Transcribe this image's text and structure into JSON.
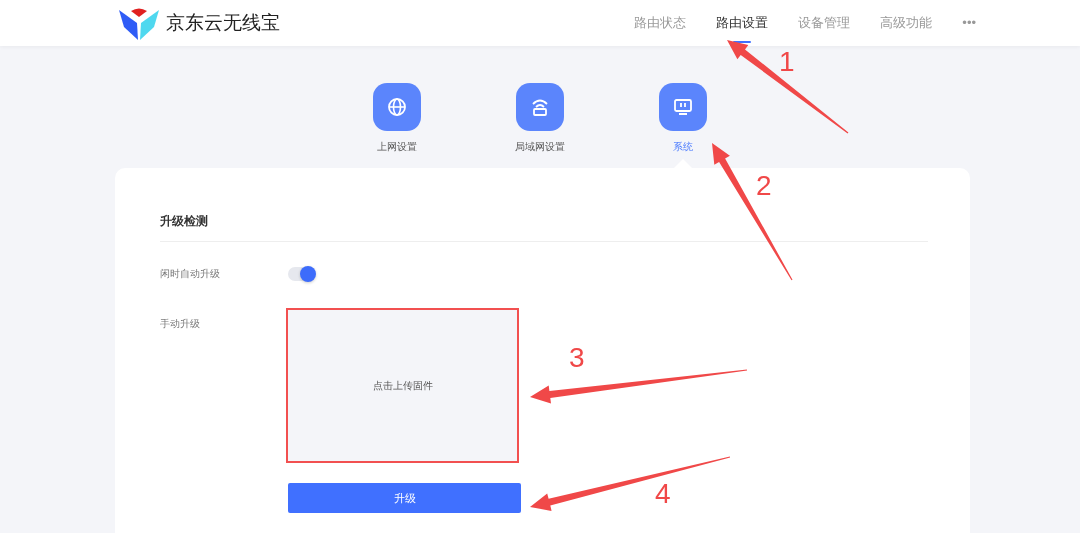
{
  "brand": {
    "name": "京东云无线宝"
  },
  "nav": [
    {
      "label": "路由状态",
      "selected": false
    },
    {
      "label": "路由设置",
      "selected": true
    },
    {
      "label": "设备管理",
      "selected": false
    },
    {
      "label": "高级功能",
      "selected": false
    },
    {
      "label": "•••",
      "selected": false
    }
  ],
  "categories": [
    {
      "label": "上网设置",
      "kind": "globe",
      "selected": false
    },
    {
      "label": "局域网设置",
      "kind": "router",
      "selected": false
    },
    {
      "label": "系统",
      "kind": "monitor",
      "selected": true
    }
  ],
  "section": {
    "title": "升级检测"
  },
  "auto_upgrade": {
    "label": "闲时自动升级",
    "on": true
  },
  "manual_upgrade": {
    "label": "手动升级",
    "upload_text": "点击上传固件",
    "highlighted": true,
    "button": "升级"
  },
  "annotations": [
    {
      "label": "1"
    },
    {
      "label": "2"
    },
    {
      "label": "3"
    },
    {
      "label": "4"
    }
  ]
}
